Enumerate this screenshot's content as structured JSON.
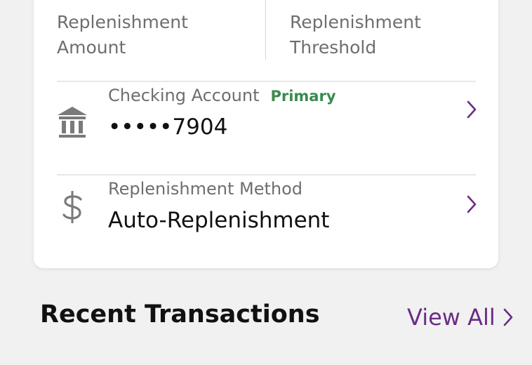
{
  "summary": {
    "amount_label_line1": "Replenishment",
    "amount_label_line2": "Amount",
    "threshold_label_line1": "Replenishment",
    "threshold_label_line2": "Threshold"
  },
  "account_row": {
    "label": "Checking Account",
    "badge": "Primary",
    "value": "•••••7904",
    "icon": "bank-icon"
  },
  "method_row": {
    "label": "Replenishment Method",
    "value": "Auto-Replenishment",
    "icon": "dollar-icon"
  },
  "recent": {
    "title": "Recent Transactions",
    "view_all": "View All"
  },
  "colors": {
    "accent": "#6c2c83",
    "primary_badge": "#3a8a4f",
    "muted_text": "#6e6e6e",
    "background": "#f1f1f2"
  }
}
